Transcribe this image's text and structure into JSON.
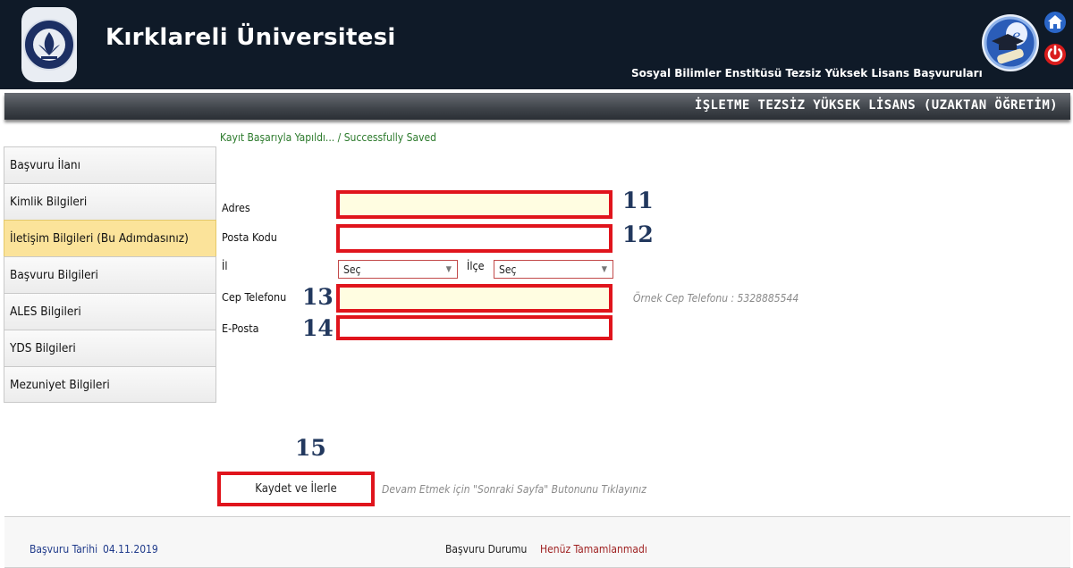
{
  "header": {
    "university": "Kırklareli Üniversitesi",
    "subtitle": "Sosyal Bilimler Enstitüsü Tezsiz Yüksek Lisans Başvuruları",
    "logo_text": "KIRKLARELİ ÜNİVERSİTESİ 2007",
    "icons": [
      "university-logo",
      "e-diploma-icon",
      "home-icon",
      "power-icon"
    ]
  },
  "band": {
    "title": "İŞLETME TEZSİZ YÜKSEK LİSANS (UZAKTAN ÖĞRETİM)"
  },
  "status_message": "Kayıt Başarıyla Yapıldı... / Successfully Saved",
  "sidebar": {
    "items": [
      {
        "label": "Başvuru İlanı",
        "active": false
      },
      {
        "label": "Kimlik Bilgileri",
        "active": false
      },
      {
        "label": "İletişim Bilgileri (Bu Adımdasınız)",
        "active": true
      },
      {
        "label": "Başvuru Bilgileri",
        "active": false
      },
      {
        "label": "ALES Bilgileri",
        "active": false
      },
      {
        "label": "YDS Bilgileri",
        "active": false
      },
      {
        "label": "Mezuniyet Bilgileri",
        "active": false
      }
    ]
  },
  "form": {
    "address_label": "Adres",
    "address_value": "",
    "postal_label": "Posta Kodu",
    "postal_value": "",
    "city_label": "İl",
    "city_value": "Seç",
    "district_label": "İlçe",
    "district_value": "Seç",
    "phone_label": "Cep Telefonu",
    "phone_value": "",
    "phone_hint": "Örnek Cep Telefonu : 5328885544",
    "email_label": "E-Posta",
    "email_value": ""
  },
  "annotations": {
    "n11": "11",
    "n12": "12",
    "n13": "13",
    "n14": "14",
    "n15": "15"
  },
  "save_button": "Kaydet ve İlerle",
  "save_hint": "Devam Etmek için \"Sonraki Sayfa\" Butonunu Tıklayınız",
  "footer": {
    "date_label": "Başvuru Tarihi",
    "date_value": "04.11.2019",
    "status_label": "Başvuru Durumu",
    "status_value": "Henüz Tamamlanmadı"
  },
  "colors": {
    "header_bg": "#0f1a28",
    "highlight_border": "#e0141c",
    "active_item": "#fbe39a",
    "success_text": "#2c7a2c"
  }
}
